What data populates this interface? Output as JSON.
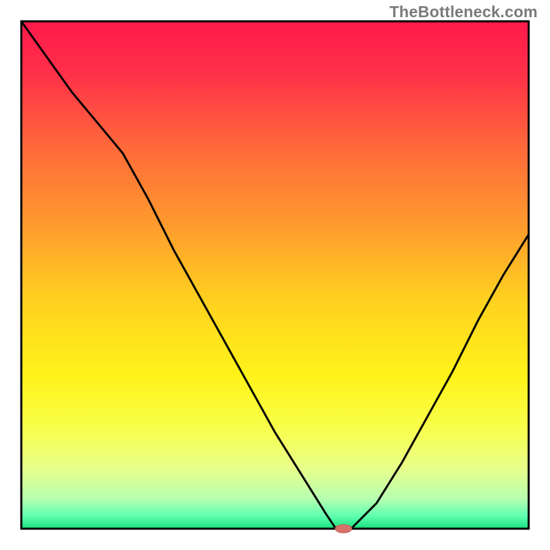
{
  "watermark": "TheBottleneck.com",
  "chart_data": {
    "type": "line",
    "title": "",
    "xlabel": "",
    "ylabel": "",
    "xlim": [
      0,
      100
    ],
    "ylim": [
      0,
      100
    ],
    "grid": false,
    "legend": false,
    "background_gradient": {
      "stops": [
        {
          "offset": 0.0,
          "color": "#ff1a4b"
        },
        {
          "offset": 0.1,
          "color": "#ff2f49"
        },
        {
          "offset": 0.25,
          "color": "#ff6a3a"
        },
        {
          "offset": 0.4,
          "color": "#ff9a2e"
        },
        {
          "offset": 0.55,
          "color": "#ffd11f"
        },
        {
          "offset": 0.7,
          "color": "#fff31a"
        },
        {
          "offset": 0.8,
          "color": "#f8ff4a"
        },
        {
          "offset": 0.88,
          "color": "#e8ff8a"
        },
        {
          "offset": 0.94,
          "color": "#b8ffb0"
        },
        {
          "offset": 0.975,
          "color": "#5fffb0"
        },
        {
          "offset": 1.0,
          "color": "#18e07e"
        }
      ]
    },
    "series": [
      {
        "name": "bottleneck-curve",
        "x": [
          0,
          5,
          10,
          15,
          20,
          25,
          30,
          35,
          40,
          45,
          50,
          55,
          60,
          62,
          65,
          70,
          75,
          80,
          85,
          90,
          95,
          100
        ],
        "y": [
          100,
          93,
          86,
          80,
          74,
          65,
          55,
          46,
          37,
          28,
          19,
          11,
          3,
          0,
          0,
          5,
          13,
          22,
          31,
          41,
          50,
          58
        ]
      }
    ],
    "marker": {
      "name": "optimal-point",
      "x": 63.5,
      "y": 0,
      "color": "#d6726a",
      "rx": 12,
      "ry": 6
    }
  }
}
